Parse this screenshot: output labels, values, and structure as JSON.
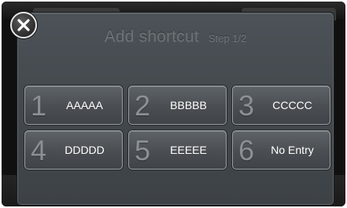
{
  "dialog": {
    "title": "Add shortcut",
    "step": "Step 1/2"
  },
  "close_icon": "close-icon",
  "shortcuts": [
    {
      "number": "1",
      "label": "AAAAA"
    },
    {
      "number": "2",
      "label": "BBBBB"
    },
    {
      "number": "3",
      "label": "CCCCC"
    },
    {
      "number": "4",
      "label": "DDDDD"
    },
    {
      "number": "5",
      "label": "EEEEE"
    },
    {
      "number": "6",
      "label": "No Entry"
    }
  ],
  "colors": {
    "dialog_bg": "#474c51",
    "button_border": "#9aa0a5",
    "title_text": "#6b7176",
    "label_text": "#ffffff"
  }
}
